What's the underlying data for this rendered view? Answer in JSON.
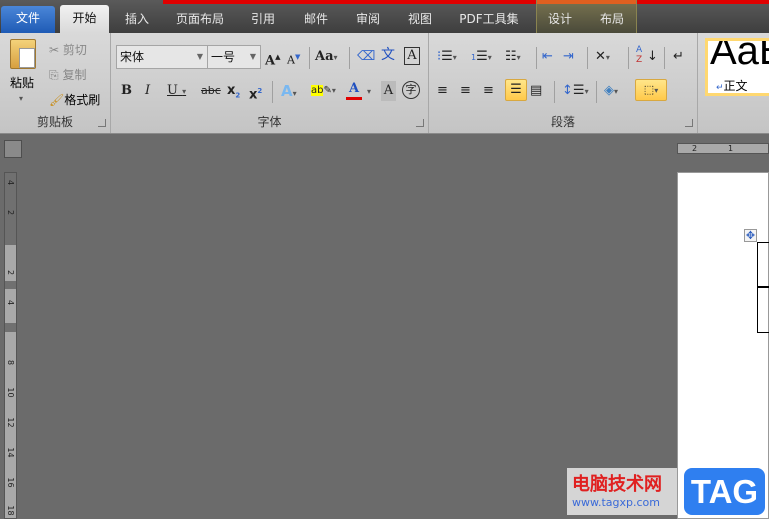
{
  "tabs": {
    "file": "文件",
    "home": "开始",
    "insert": "插入",
    "layout": "页面布局",
    "references": "引用",
    "mailings": "邮件",
    "review": "审阅",
    "view": "视图",
    "pdf": "PDF工具集",
    "design": "设计",
    "table_layout": "布局"
  },
  "clipboard": {
    "paste": "粘贴",
    "cut": "剪切",
    "copy": "复制",
    "format_painter": "格式刷",
    "label": "剪贴板"
  },
  "font": {
    "name": "宋体",
    "size": "一号",
    "label": "字体",
    "accent_color": "#e00000"
  },
  "paragraph": {
    "label": "段落"
  },
  "styles": {
    "preview": "AaB",
    "normal": "正文"
  },
  "ruler": {
    "h_ticks": [
      "2",
      "1"
    ],
    "v_ticks": [
      "4",
      "2",
      "2",
      "4",
      "8",
      "10",
      "12",
      "14",
      "16",
      "18"
    ]
  },
  "watermark": {
    "site": "电脑技术网",
    "url": "www.tagxp.com",
    "tag": "TAG"
  }
}
